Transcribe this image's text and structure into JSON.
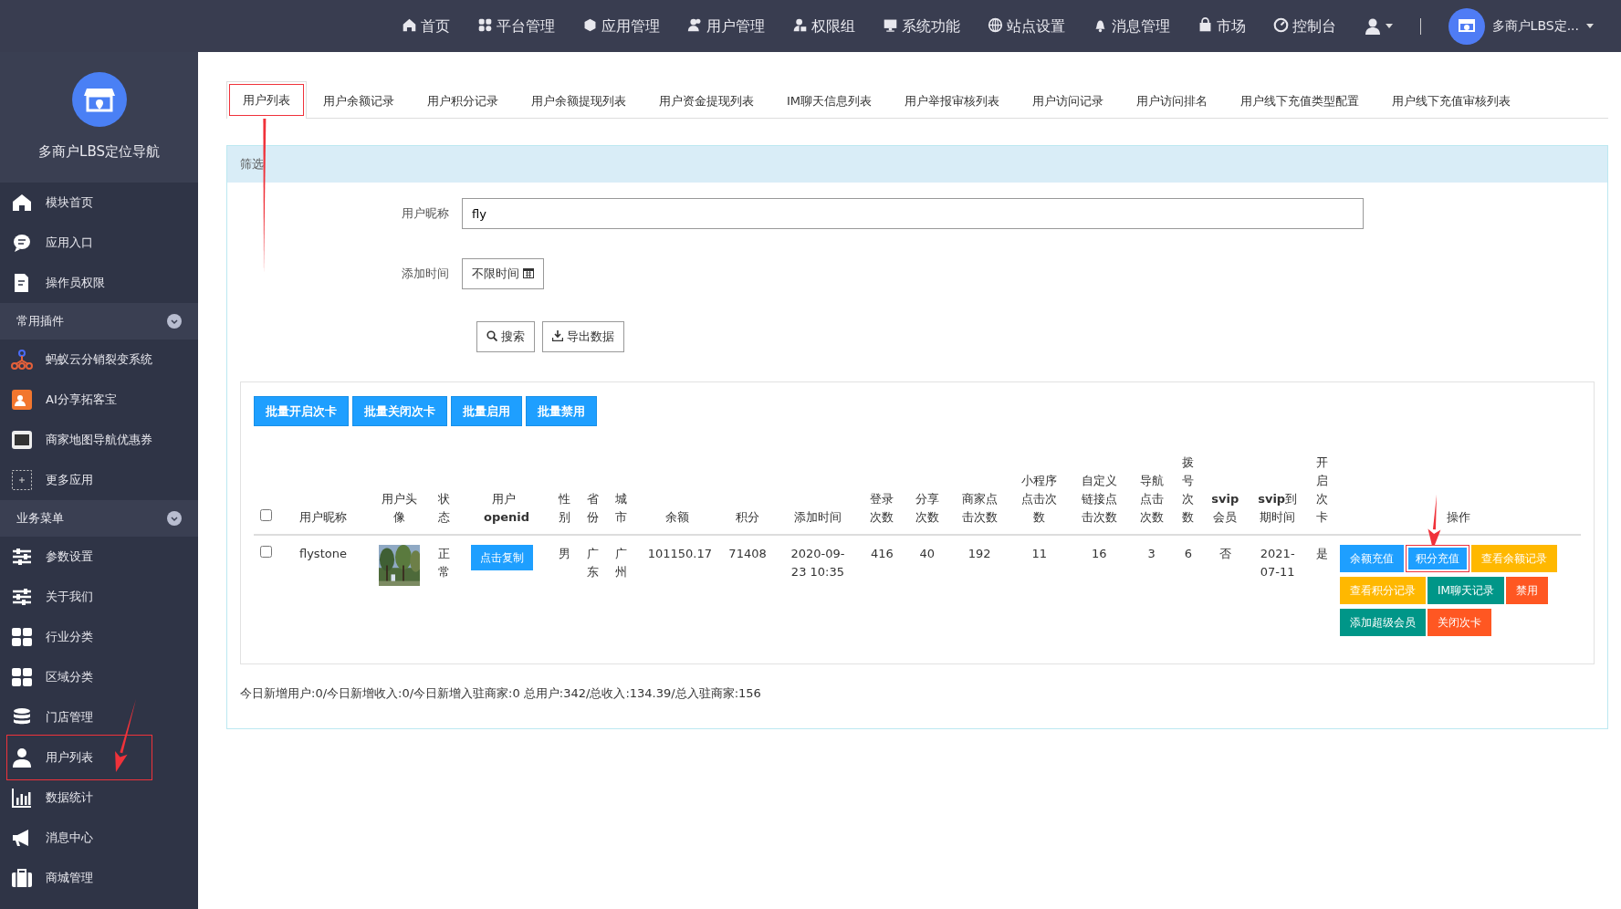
{
  "topnav": {
    "items": [
      {
        "label": "首页"
      },
      {
        "label": "平台管理"
      },
      {
        "label": "应用管理"
      },
      {
        "label": "用户管理"
      },
      {
        "label": "权限组"
      },
      {
        "label": "系统功能"
      },
      {
        "label": "站点设置"
      },
      {
        "label": "消息管理"
      },
      {
        "label": "市场"
      },
      {
        "label": "控制台"
      }
    ],
    "site_name": "多商户LBS定..."
  },
  "sidebar": {
    "brand": "多商户LBS定位导航",
    "items": [
      {
        "label": "模块首页",
        "highlighted": false
      },
      {
        "label": "应用入口",
        "highlighted": false
      },
      {
        "label": "操作员权限",
        "highlighted": false
      }
    ],
    "sections": [
      {
        "title": "常用插件",
        "items": [
          {
            "label": "蚂蚁云分销裂变系统",
            "highlighted": false
          },
          {
            "label": "AI分享拓客宝",
            "highlighted": false
          },
          {
            "label": "商家地图导航优惠券",
            "highlighted": false
          },
          {
            "label": "更多应用",
            "highlighted": false
          }
        ]
      },
      {
        "title": "业务菜单",
        "items": [
          {
            "label": "参数设置",
            "highlighted": false
          },
          {
            "label": "关于我们",
            "highlighted": false
          },
          {
            "label": "行业分类",
            "highlighted": false
          },
          {
            "label": "区域分类",
            "highlighted": false
          },
          {
            "label": "门店管理",
            "highlighted": false
          },
          {
            "label": "用户列表",
            "highlighted": true
          },
          {
            "label": "数据统计",
            "highlighted": false
          },
          {
            "label": "消息中心",
            "highlighted": false
          },
          {
            "label": "商城管理",
            "highlighted": false
          }
        ]
      }
    ]
  },
  "tabs": [
    {
      "label": "用户列表",
      "selected": true,
      "highlighted": true
    },
    {
      "label": "用户余额记录",
      "selected": false,
      "highlighted": false
    },
    {
      "label": "用户积分记录",
      "selected": false,
      "highlighted": false
    },
    {
      "label": "用户余额提现列表",
      "selected": false,
      "highlighted": false
    },
    {
      "label": "用户资金提现列表",
      "selected": false,
      "highlighted": false
    },
    {
      "label": "IM聊天信息列表",
      "selected": false,
      "highlighted": false
    },
    {
      "label": "用户举报审核列表",
      "selected": false,
      "highlighted": false
    },
    {
      "label": "用户访问记录",
      "selected": false,
      "highlighted": false
    },
    {
      "label": "用户访问排名",
      "selected": false,
      "highlighted": false
    },
    {
      "label": "用户线下充值类型配置",
      "selected": false,
      "highlighted": false
    },
    {
      "label": "用户线下充值审核列表",
      "selected": false,
      "highlighted": false
    }
  ],
  "filter": {
    "title": "筛选",
    "nickname": {
      "label": "用户昵称",
      "value": "fly"
    },
    "add_time": {
      "label": "添加时间",
      "button": "不限时间"
    },
    "search_button": "搜索",
    "export_button": "导出数据"
  },
  "batch_buttons": [
    "批量开启次卡",
    "批量关闭次卡",
    "批量启用",
    "批量禁用"
  ],
  "table": {
    "header_checked": false,
    "columns": [
      "用户昵称",
      "用户头像",
      "状态",
      "用户**openid**",
      "性别",
      "省份",
      "城市",
      "余额",
      "积分",
      "添加时间",
      "登录次数",
      "分享次数",
      "商家点击次数",
      "小程序点击次数",
      "自定义链接点击次数",
      "导航点击次数",
      "拨号次数",
      "**svip**会员",
      "**svip**到期时间",
      "开启次卡",
      "操作"
    ],
    "rows": [
      {
        "checked": false,
        "cells": [
          {
            "kind": "text",
            "text": "flystone"
          },
          {
            "kind": "picture"
          },
          {
            "kind": "text",
            "text": "正常"
          },
          {
            "kind": "button",
            "text": "点击复制"
          },
          {
            "kind": "text",
            "text": "男"
          },
          {
            "kind": "text",
            "text": "广东"
          },
          {
            "kind": "text",
            "text": "广州"
          },
          {
            "kind": "text",
            "text": "101150.17"
          },
          {
            "kind": "text",
            "text": "71408"
          },
          {
            "kind": "text",
            "text": "2020-09-23 10:35"
          },
          {
            "kind": "text",
            "text": "416"
          },
          {
            "kind": "text",
            "text": "40"
          },
          {
            "kind": "text",
            "text": "192"
          },
          {
            "kind": "text",
            "text": "11"
          },
          {
            "kind": "text",
            "text": "16"
          },
          {
            "kind": "text",
            "text": "3"
          },
          {
            "kind": "text",
            "text": "6"
          },
          {
            "kind": "text",
            "text": "否"
          },
          {
            "kind": "text",
            "text": "2021-07-11"
          },
          {
            "kind": "text",
            "text": "是"
          }
        ],
        "actions": [
          {
            "label": "余额充值",
            "color": "#1e9fff",
            "highlighted": false
          },
          {
            "label": "积分充值",
            "color": "#1e9fff",
            "highlighted": true
          },
          {
            "label": "查看余额记录",
            "color": "#ffb800",
            "highlighted": false
          },
          {
            "label": "查看积分记录",
            "color": "#ffb800",
            "highlighted": false
          },
          {
            "label": "IM聊天记录",
            "color": "#009688",
            "highlighted": false
          },
          {
            "label": "禁用",
            "color": "#ff5722",
            "highlighted": false
          },
          {
            "label": "添加超级会员",
            "color": "#009688",
            "highlighted": false
          },
          {
            "label": "关闭次卡",
            "color": "#ff5722",
            "highlighted": false
          }
        ]
      }
    ]
  },
  "footer": "今日新增用户:0/今日新增收入:0/今日新增入驻商家:0 总用户:342/总收入:134.39/总入驻商家:156"
}
